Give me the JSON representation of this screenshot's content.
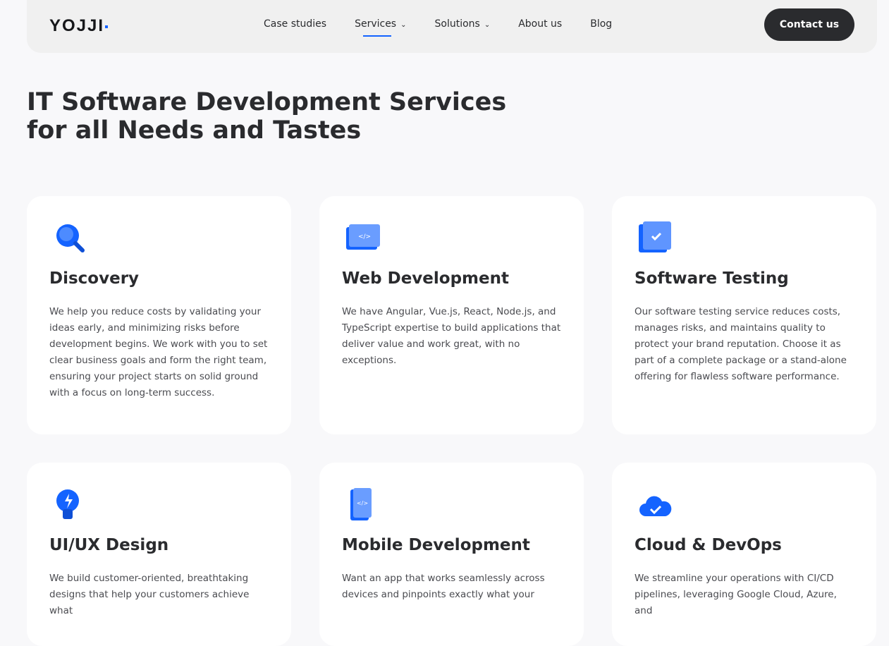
{
  "header": {
    "logo": "YOJJI",
    "nav": [
      {
        "label": "Case studies"
      },
      {
        "label": "Services",
        "dropdown": true,
        "active": true
      },
      {
        "label": "Solutions",
        "dropdown": true
      },
      {
        "label": "About us"
      },
      {
        "label": "Blog"
      }
    ],
    "contact": "Contact us"
  },
  "hero": {
    "title_line1": "IT Software Development Services",
    "title_line2": "for all Needs and Tastes"
  },
  "cards": [
    {
      "icon": "magnifier-icon",
      "title": "Discovery",
      "text": "We help you reduce costs by validating your ideas early, and minimizing risks before development begins. We work with you to set clear business goals and form the right team, ensuring your project starts on solid ground with a focus on long-term success."
    },
    {
      "icon": "code-window-icon",
      "title": "Web Development",
      "text": "We have Angular, Vue.js, React, Node.js, and TypeScript expertise to build applications that deliver value and work great, with no exceptions."
    },
    {
      "icon": "checkbox-icon",
      "title": "Software Testing",
      "text": "Our software testing service reduces costs, manages risks, and maintains quality to protect your brand reputation. Choose it as part of a complete package or a stand-alone offering for flawless software performance."
    },
    {
      "icon": "lightbulb-icon",
      "title": "UI/UX Design",
      "text": "We build customer-oriented, breathtaking designs that help your customers achieve what"
    },
    {
      "icon": "mobile-code-icon",
      "title": "Mobile Development",
      "text": "Want an app that works seamlessly across devices and pinpoints exactly what your"
    },
    {
      "icon": "cloud-check-icon",
      "title": "Cloud & DevOps",
      "text": "We streamline your operations with CI/CD pipelines, leveraging Google Cloud, Azure, and"
    }
  ],
  "colors": {
    "accent": "#1463ff",
    "dark": "#2a2b2e"
  }
}
